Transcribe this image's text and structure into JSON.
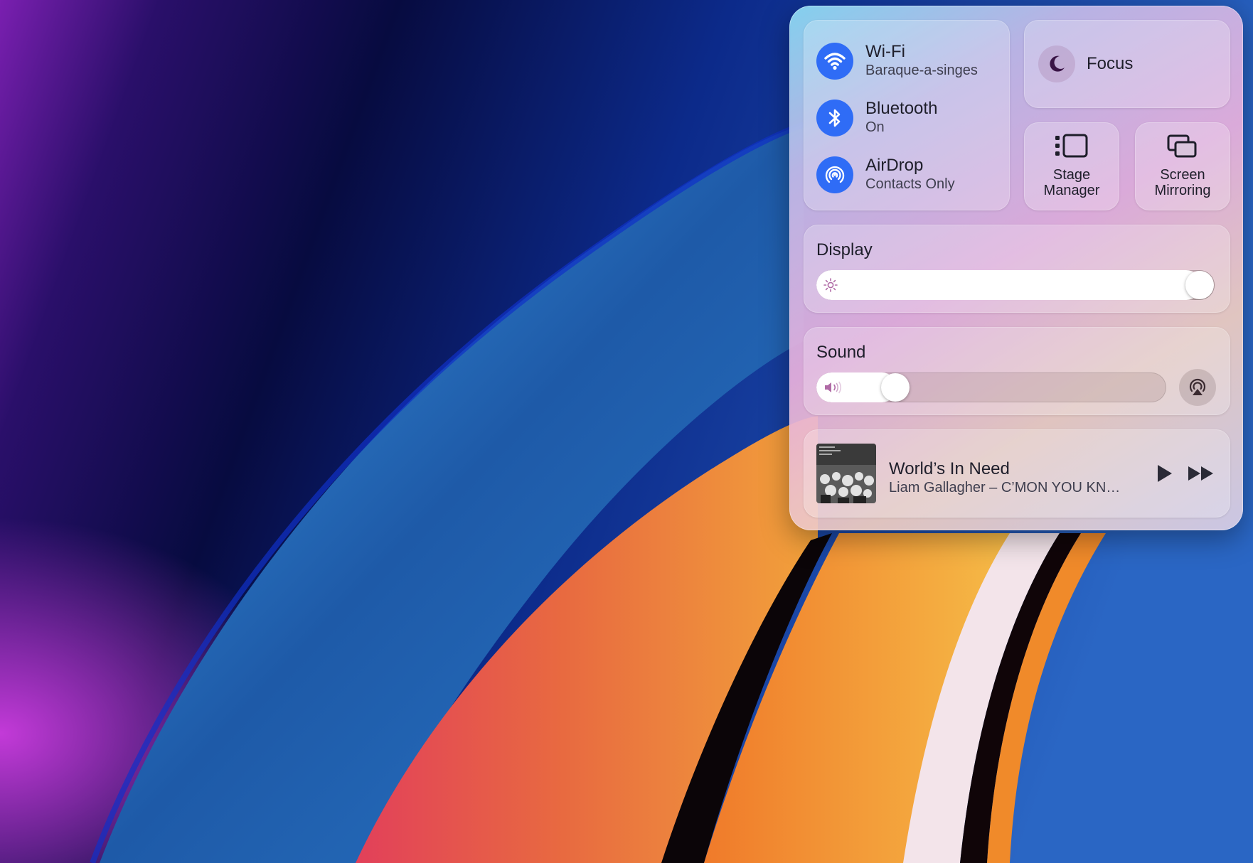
{
  "desktop": {
    "wallpaper": "macOS abstract wallpaper"
  },
  "control_center": {
    "connectivity": [
      {
        "id": "wifi",
        "icon": "wifi-icon",
        "title": "Wi-Fi",
        "subtitle": "Baraque-a-singes"
      },
      {
        "id": "bluetooth",
        "icon": "bluetooth-icon",
        "title": "Bluetooth",
        "subtitle": "On"
      },
      {
        "id": "airdrop",
        "icon": "airdrop-icon",
        "title": "AirDrop",
        "subtitle": "Contacts Only"
      }
    ],
    "focus": {
      "label": "Focus",
      "icon": "moon-icon"
    },
    "stage_manager": {
      "label": "Stage\nManager",
      "icon": "stage-manager-icon"
    },
    "screen_mirroring": {
      "label": "Screen\nMirroring",
      "icon": "screen-mirroring-icon"
    },
    "display": {
      "label": "Display",
      "brightness": 1.0,
      "icon": "sun-icon"
    },
    "sound": {
      "label": "Sound",
      "volume": 0.2,
      "icon": "speaker-icon",
      "output_icon": "airplay-audio-icon"
    },
    "now_playing": {
      "title": "World’s In Need",
      "subtitle": "Liam Gallagher – C’MON YOU KN…",
      "play_icon": "play-icon",
      "next_icon": "fast-forward-icon"
    },
    "colors": {
      "accent": "#2f6cf6",
      "text": "#1e1e2a",
      "secondary_text": "#3e3e4e"
    }
  }
}
